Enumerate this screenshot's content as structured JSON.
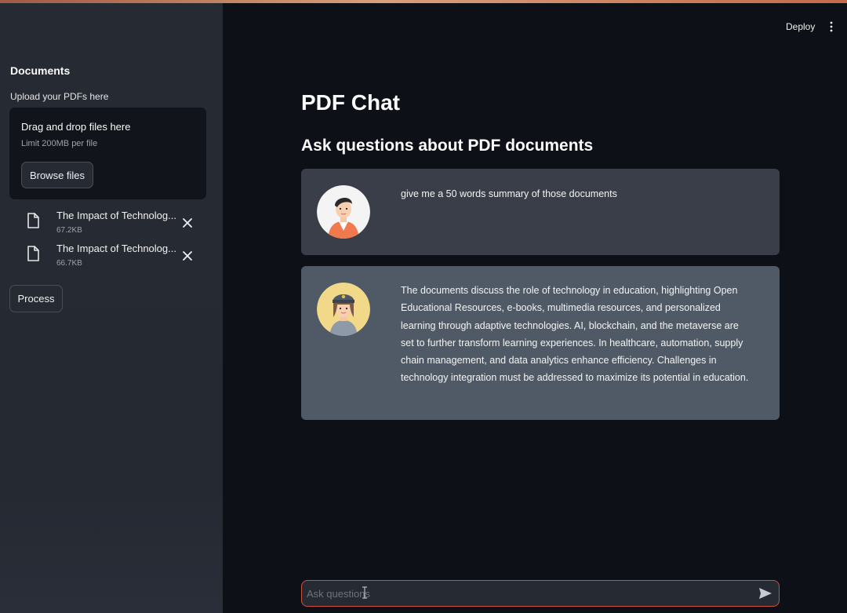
{
  "sidebar": {
    "heading": "Documents",
    "uploader_label": "Upload your PDFs here",
    "dropzone": {
      "title": "Drag and drop files here",
      "limit": "Limit 200MB per file",
      "browse_label": "Browse files"
    },
    "files": [
      {
        "name": "The Impact of Technolog...",
        "size": "67.2KB",
        "icon": "file-icon"
      },
      {
        "name": "The Impact of Technolog...",
        "size": "66.7KB",
        "icon": "file-icon"
      }
    ],
    "process_label": "Process"
  },
  "header": {
    "deploy_label": "Deploy",
    "menu_icon": "vertical-dots-icon"
  },
  "main": {
    "title": "PDF Chat",
    "subtitle": "Ask questions about PDF documents",
    "messages": [
      {
        "role": "user",
        "avatar": "user-avatar",
        "text": "give me a 50 words summary of those documents"
      },
      {
        "role": "assistant",
        "avatar": "bot-avatar",
        "text": "The documents discuss the role of technology in education, highlighting Open Educational Resources, e-books, multimedia resources, and personalized learning through adaptive technologies. AI, blockchain, and the metaverse are set to further transform learning experiences. In healthcare, automation, supply chain management, and data analytics enhance efficiency. Challenges in technology integration must be addressed to maximize its potential in education."
      }
    ],
    "chat_input": {
      "placeholder": "Ask questions",
      "value": "",
      "send_icon": "send-icon"
    }
  },
  "colors": {
    "background": "#0e1117",
    "sidebar": "#262a33",
    "user_bubble": "#3a3e49",
    "bot_bubble": "#4f5a66",
    "input_border": "#d0503f"
  }
}
